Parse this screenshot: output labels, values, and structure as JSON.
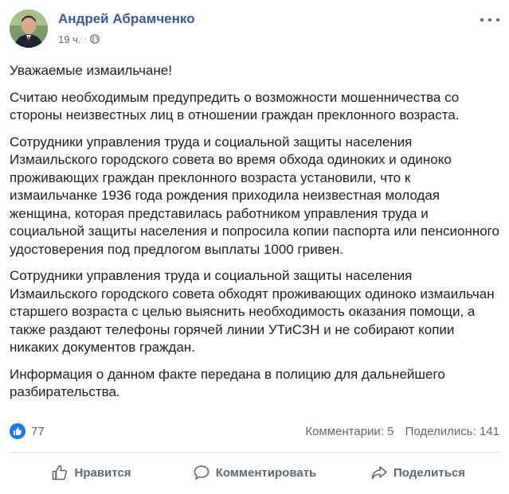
{
  "post": {
    "author": "Андрей Абрамченко",
    "time": "19 ч.",
    "separator": "·",
    "privacy_icon": "globe-icon",
    "more_icon": "more-options-icon",
    "paragraphs": [
      "Уважаемые измаильчане!",
      "Считаю необходимым предупредить о возможности мошенничества со стороны неизвестных лиц в отношении граждан преклонного возраста.",
      "Сотрудники управления труда и социальной защиты населения Измаильского городского совета во время обхода одиноких и одиноко проживающих граждан преклонного возраста установили, что к измаильчанке 1936 года рождения приходила неизвестная молодая женщина, которая представилась работником управления труда и социальной защиты населения и попросила копии паспорта или пенсионного удостоверения под предлогом выплаты 1000 гривен.",
      "Сотрудники управления труда и социальной защиты населения Измаильского городского совета обходят проживающих одиноко измаильчан старшего возраста с целью выяснить необходимость оказания помощи, а также раздают телефоны горячей линии УТиСЗН и не собирают копии никаких документов граждан.",
      "Информация о данном факте передана в полицию для дальнейшего разбирательства."
    ]
  },
  "reactions": {
    "like_count": "77",
    "comments": "Комментарии: 5",
    "shares": "Поделились: 141"
  },
  "actions": {
    "like": "Нравится",
    "comment": "Комментировать",
    "share": "Поделиться"
  },
  "colors": {
    "author": "#385898",
    "secondary_text": "#606770",
    "like_blue": "#1877f2"
  }
}
